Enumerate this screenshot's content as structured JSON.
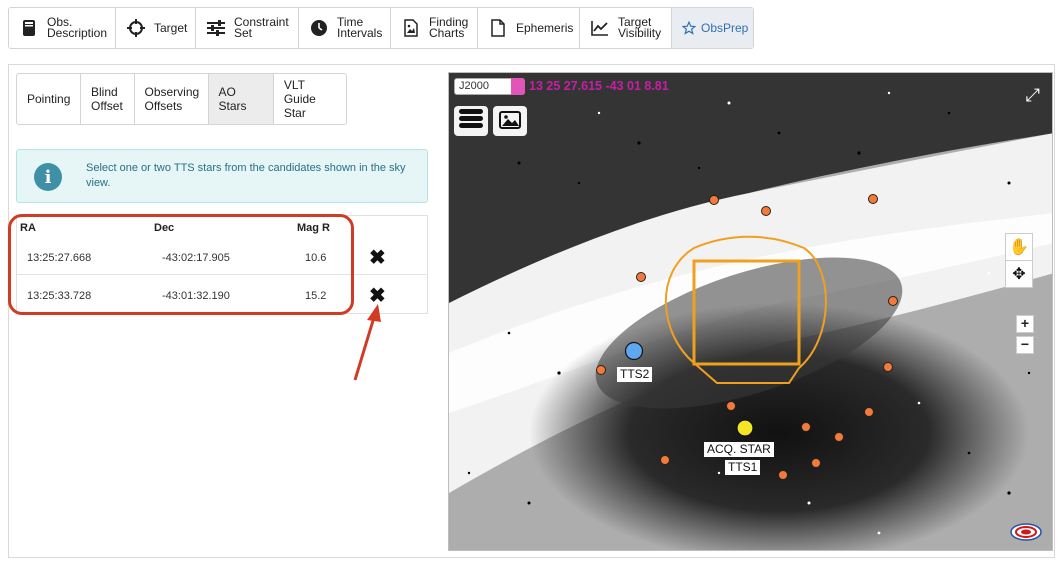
{
  "top_tabs": [
    {
      "label": "Obs.\nDescription",
      "icon": "book-icon",
      "active": false
    },
    {
      "label": "Target",
      "icon": "crosshair-icon",
      "active": false
    },
    {
      "label": "Constraint\nSet",
      "icon": "sliders-icon",
      "active": false
    },
    {
      "label": "Time\nIntervals",
      "icon": "clock-icon",
      "active": false
    },
    {
      "label": "Finding\nCharts",
      "icon": "image-file-icon",
      "active": false
    },
    {
      "label": "Ephemeris",
      "icon": "file-icon",
      "active": false
    },
    {
      "label": "Target\nVisibility",
      "icon": "line-chart-icon",
      "active": false
    },
    {
      "label": "ObsPrep",
      "icon": "star-icon",
      "active": true
    }
  ],
  "sub_tabs": [
    {
      "label": "Pointing",
      "active": false
    },
    {
      "label": "Blind\nOffset",
      "active": false
    },
    {
      "label": "Observing\nOffsets",
      "active": false
    },
    {
      "label": "AO Stars",
      "active": true
    },
    {
      "label": "VLT Guide\nStar",
      "active": false
    }
  ],
  "info": {
    "icon": "info-icon",
    "text": "Select one or two TTS stars from the candidates shown in the sky view."
  },
  "table": {
    "headers": {
      "ra": "RA",
      "dec": "Dec",
      "mag": "Mag R"
    },
    "rows": [
      {
        "ra": "13:25:27.668",
        "dec": "-43:02:17.905",
        "mag": "10.6",
        "delete_icon": "close-icon"
      },
      {
        "ra": "13:25:33.728",
        "dec": "-43:01:32.190",
        "mag": "15.2",
        "delete_icon": "close-icon"
      }
    ]
  },
  "annotation": {
    "color": "#d13b24"
  },
  "sky_view": {
    "frame": "J2000",
    "coords": "13 25 27.615 -43 01 8.81",
    "labels": {
      "tts2": "TTS2",
      "acq": "ACQ. STAR",
      "tts1": "TTS1"
    },
    "colors": {
      "candidate": "#f47a3a",
      "tts2": "#5fa8f0",
      "acq": "#f5e625",
      "fov": "#f0a020",
      "coords": "#c61ea5"
    },
    "zoom_in": "+",
    "zoom_out": "−"
  }
}
